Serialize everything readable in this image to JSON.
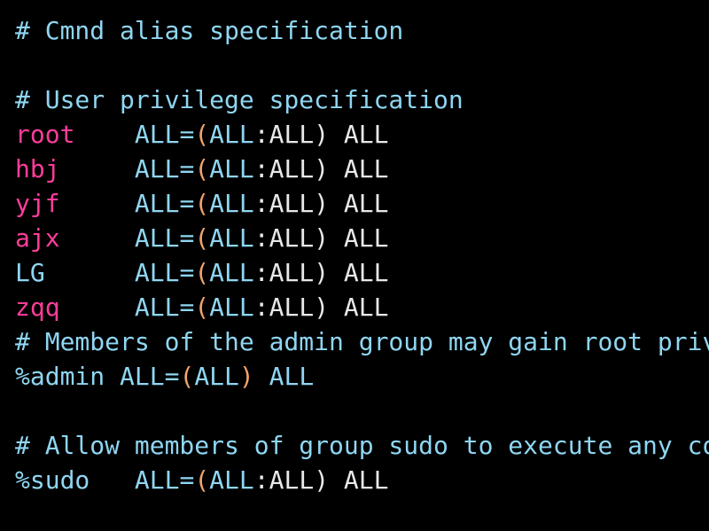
{
  "colors": {
    "background": "#000000",
    "comment": "#8fd6f2",
    "username": "#ff3d9a",
    "keyword": "#8fd6f2",
    "paren": "#f2a46b",
    "default_text": "#e8e8e8"
  },
  "lines": [
    {
      "type": "comment",
      "text": "# Cmnd alias specification"
    },
    {
      "type": "blank",
      "text": ""
    },
    {
      "type": "comment",
      "text": "# User privilege specification"
    },
    {
      "type": "rule",
      "user": "root",
      "user_color": "pink",
      "spec": {
        "hosts": "ALL",
        "runas_user": "ALL",
        "runas_group": "ALL",
        "commands": "ALL"
      }
    },
    {
      "type": "rule",
      "user": "hbj",
      "user_color": "pink",
      "spec": {
        "hosts": "ALL",
        "runas_user": "ALL",
        "runas_group": "ALL",
        "commands": "ALL"
      }
    },
    {
      "type": "rule",
      "user": "yjf",
      "user_color": "pink",
      "spec": {
        "hosts": "ALL",
        "runas_user": "ALL",
        "runas_group": "ALL",
        "commands": "ALL"
      }
    },
    {
      "type": "rule",
      "user": "ajx",
      "user_color": "pink",
      "spec": {
        "hosts": "ALL",
        "runas_user": "ALL",
        "runas_group": "ALL",
        "commands": "ALL"
      }
    },
    {
      "type": "rule",
      "user": "LG",
      "user_color": "cyan",
      "spec": {
        "hosts": "ALL",
        "runas_user": "ALL",
        "runas_group": "ALL",
        "commands": "ALL"
      }
    },
    {
      "type": "rule",
      "user": "zqq",
      "user_color": "pink",
      "spec": {
        "hosts": "ALL",
        "runas_user": "ALL",
        "runas_group": "ALL",
        "commands": "ALL"
      }
    },
    {
      "type": "comment",
      "text": "# Members of the admin group may gain root privileges"
    },
    {
      "type": "group_rule",
      "user": "%admin",
      "spec": {
        "hosts": "ALL",
        "runas_user": "ALL",
        "commands": "ALL"
      }
    },
    {
      "type": "blank",
      "text": ""
    },
    {
      "type": "comment",
      "text": "# Allow members of group sudo to execute any command"
    },
    {
      "type": "rule",
      "user": "%sudo",
      "user_color": "cyan",
      "spec": {
        "hosts": "ALL",
        "runas_user": "ALL",
        "runas_group": "ALL",
        "commands": "ALL"
      }
    }
  ]
}
